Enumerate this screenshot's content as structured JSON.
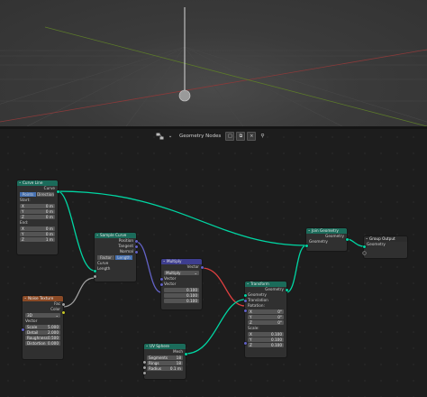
{
  "header": {
    "editor_name": "Geometry Nodes",
    "icons": [
      "node-editor-icon",
      "new-tree-icon",
      "duplicate-icon",
      "close-icon",
      "pin-icon"
    ]
  },
  "colors": {
    "geometry_socket": "#00d6a3",
    "vector_socket": "#6363c7",
    "float_socket": "#a1a1a1",
    "color_socket": "#c7c729",
    "geometry_header": "#1b6b5a",
    "vector_header": "#3e3e8f",
    "texture_header": "#8a4a26",
    "accent_button": "#4772b3",
    "red_wire": "#e04040"
  },
  "nodes": {
    "curve_line": {
      "title": "Curve Line",
      "out_curve": "Curve",
      "mode_a": "Points",
      "mode_b": "Direction",
      "start_label": "Start:",
      "start": [
        {
          "axis": "X",
          "value": "0 m"
        },
        {
          "axis": "Y",
          "value": "0 m"
        },
        {
          "axis": "Z",
          "value": "0 m"
        }
      ],
      "end_label": "End:",
      "end": [
        {
          "axis": "X",
          "value": "0 m"
        },
        {
          "axis": "Y",
          "value": "0 m"
        },
        {
          "axis": "Z",
          "value": "1 m"
        }
      ]
    },
    "noise_texture": {
      "title": "Noise Texture",
      "out_fac": "Fac",
      "out_color": "Color",
      "dimension": "3D",
      "vector": "Vector",
      "fields": [
        {
          "label": "Scale",
          "value": "5.000"
        },
        {
          "label": "Detail",
          "value": "2.000"
        },
        {
          "label": "Roughness",
          "value": "0.500"
        },
        {
          "label": "Distortion",
          "value": "0.000"
        }
      ]
    },
    "sample_curve": {
      "title": "Sample Curve",
      "out_position": "Position",
      "out_tangent": "Tangent",
      "out_normal": "Normal",
      "mode_a": "Factor",
      "mode_b": "Length",
      "in_curve": "Curve",
      "in_length": "Length"
    },
    "multiply": {
      "title": "Multiply",
      "out_vector": "Vector",
      "operation": "Multiply",
      "in_vector_a": "Vector",
      "in_vector_b": "Vector",
      "values": [
        "0.100",
        "0.100",
        "0.100"
      ]
    },
    "transform": {
      "title": "Transform",
      "out_geometry": "Geometry",
      "in_geometry": "Geometry",
      "in_translation": "Translation",
      "rotation_label": "Rotation:",
      "rotation": [
        {
          "axis": "X",
          "value": "0°"
        },
        {
          "axis": "Y",
          "value": "0°"
        },
        {
          "axis": "Z",
          "value": "0°"
        }
      ],
      "scale_label": "Scale:",
      "scale": [
        {
          "axis": "X",
          "value": "0.100"
        },
        {
          "axis": "Y",
          "value": "0.100"
        },
        {
          "axis": "Z",
          "value": "0.100"
        }
      ]
    },
    "uv_sphere": {
      "title": "UV Sphere",
      "out_mesh": "Mesh",
      "fields": [
        {
          "label": "Segments",
          "value": "18"
        },
        {
          "label": "Rings",
          "value": "18"
        },
        {
          "label": "Radius",
          "value": "0.1 m"
        }
      ]
    },
    "join_geometry": {
      "title": "Join Geometry",
      "out_geometry": "Geometry",
      "in_geometry": "Geometry"
    },
    "group_output": {
      "title": "Group Output",
      "in_geometry": "Geometry"
    }
  }
}
